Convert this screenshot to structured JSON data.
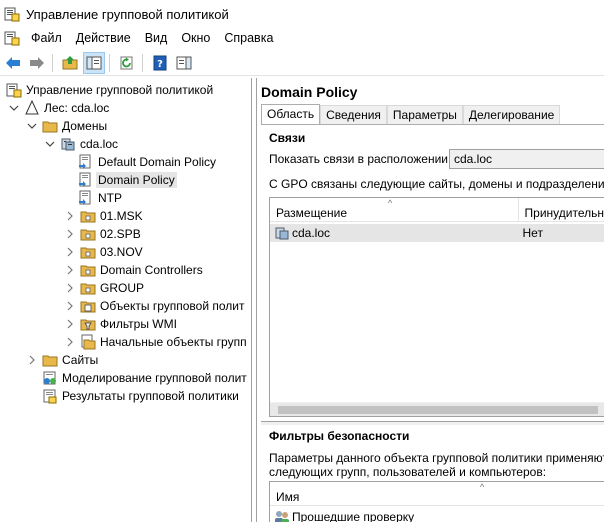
{
  "window": {
    "title": "Управление групповой политикой"
  },
  "menu": [
    "Файл",
    "Действие",
    "Вид",
    "Окно",
    "Справка"
  ],
  "tree": {
    "root": "Управление групповой политикой",
    "forest": "Лес: cda.loc",
    "domains": "Домены",
    "domain": "cda.loc",
    "items": [
      "Default Domain Policy",
      "Domain Policy",
      "NTP",
      "01.MSK",
      "02.SPB",
      "03.NOV",
      "Domain Controllers",
      "GROUP",
      "Объекты групповой полит",
      "Фильтры WMI",
      "Начальные объекты групп"
    ],
    "sites": "Сайты",
    "modeling": "Моделирование групповой полит",
    "results": "Результаты групповой политики"
  },
  "detail": {
    "title": "Domain Policy",
    "tabs": [
      "Область",
      "Сведения",
      "Параметры",
      "Делегирование"
    ],
    "links_section": "Связи",
    "show_links_label": "Показать связи в расположении:",
    "show_links_value": "cda.loc",
    "linked_text": "С GPO связаны следующие сайты, домены и подразделения:",
    "links_columns": [
      "Размещение",
      "Принудительн"
    ],
    "links_rows": [
      {
        "location": "cda.loc",
        "enforced": "Нет"
      }
    ],
    "security_section": "Фильтры безопасности",
    "security_text_1": "Параметры данного объекта групповой политики применяются то",
    "security_text_2": "следующих групп, пользователей и компьютеров:",
    "security_columns": [
      "Имя"
    ],
    "security_rows": [
      "Прошедшие проверку"
    ]
  }
}
